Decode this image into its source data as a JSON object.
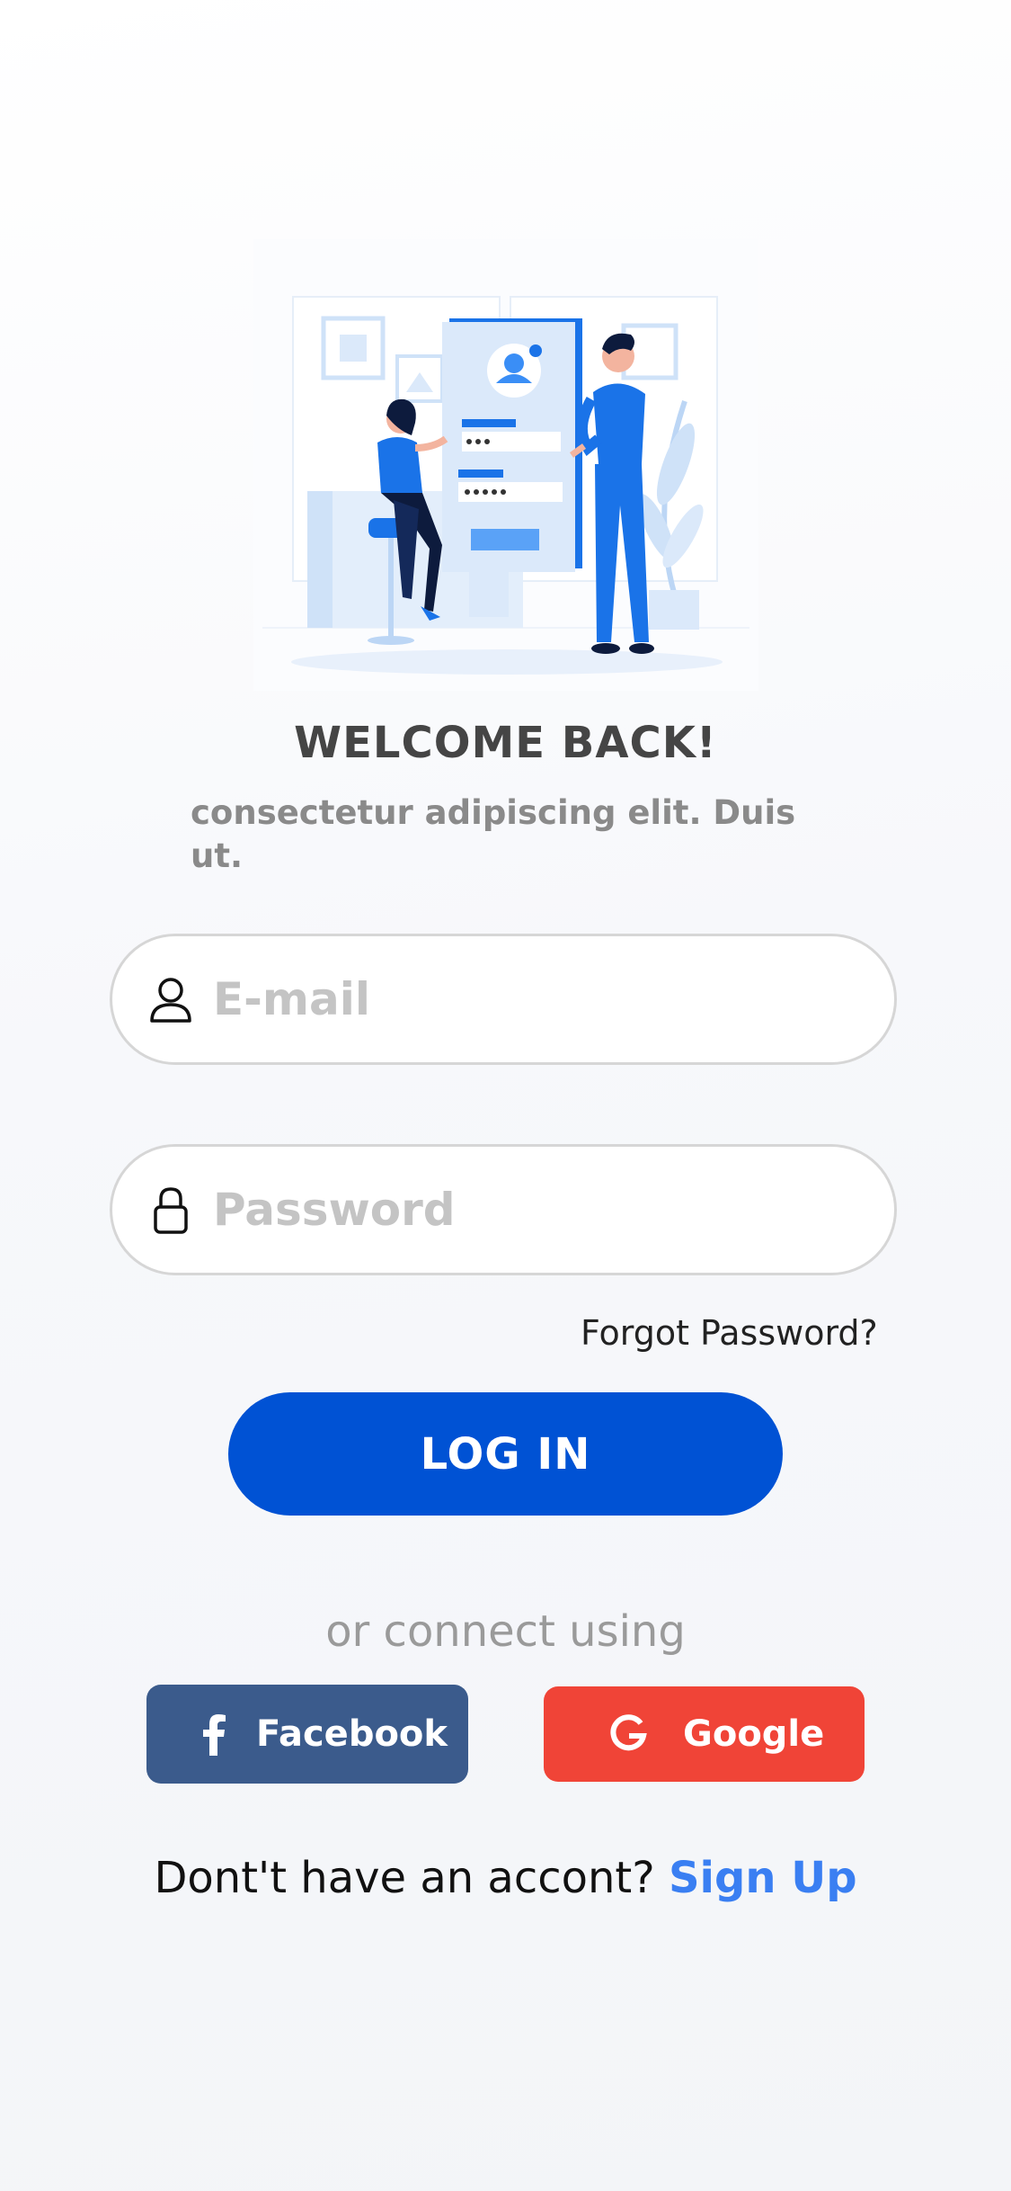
{
  "header": {
    "title": "WELCOME BACK!",
    "subtitle": "consectetur adipiscing elit. Duis ut."
  },
  "form": {
    "email_placeholder": "E-mail",
    "password_placeholder": "Password",
    "forgot_label": "Forgot Password?",
    "login_label": "LOG IN"
  },
  "social": {
    "divider_text": "or connect using",
    "facebook_label": "Facebook",
    "google_label": "Google"
  },
  "footer": {
    "prompt": "Dont't have an accont?",
    "signup_label": "Sign Up"
  },
  "colors": {
    "primary": "#0052d4",
    "facebook": "#3b5b8c",
    "google": "#f04437",
    "link": "#3a7ff2"
  }
}
